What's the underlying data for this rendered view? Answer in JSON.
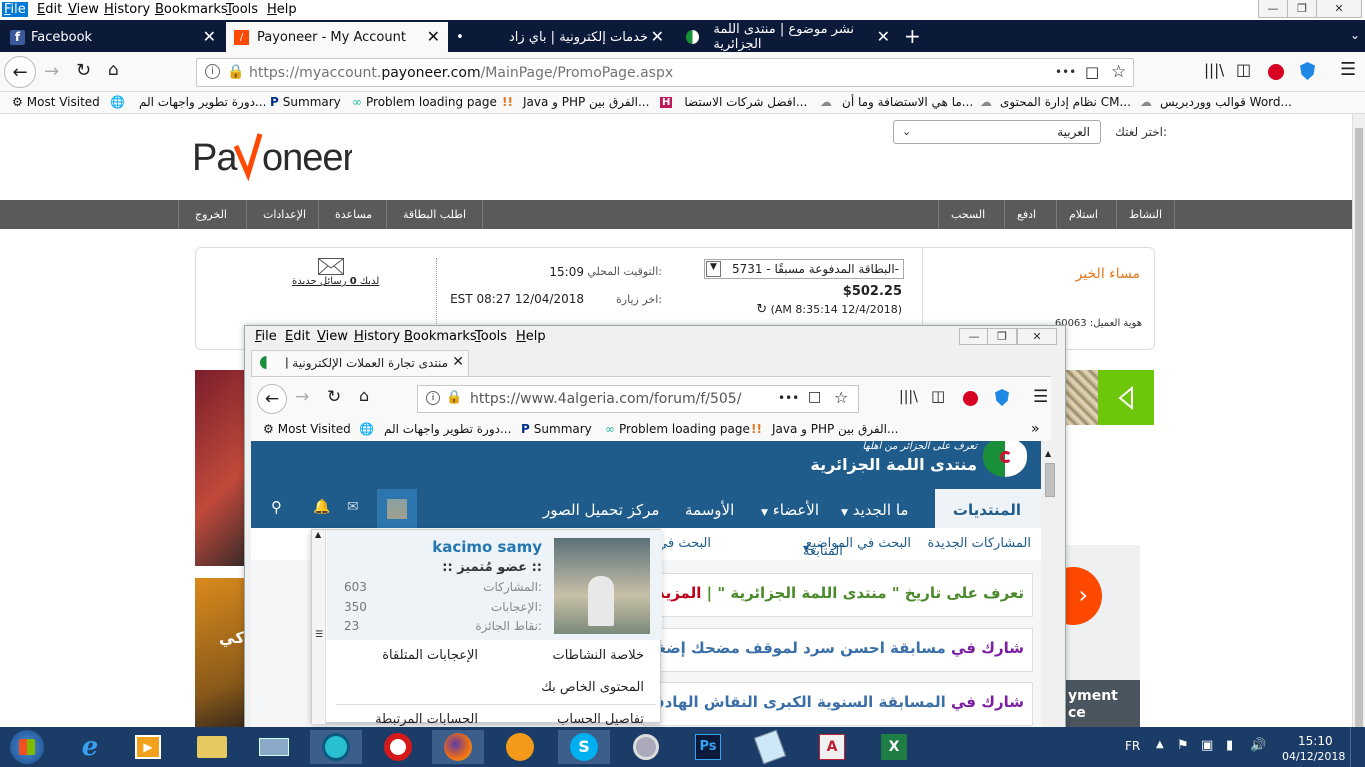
{
  "browser": {
    "menu": [
      "File",
      "Edit",
      "View",
      "History",
      "Bookmarks",
      "Tools",
      "Help"
    ],
    "tabs": [
      {
        "label": "Facebook"
      },
      {
        "label": "Payoneer - My Account"
      },
      {
        "label": "•"
      },
      {
        "label": "خدمات إلكترونية | باي زاد"
      },
      {
        "label": "نشر موضوع | منتدى اللمة الجزائرية"
      }
    ],
    "url_prefix": "https://myaccount.",
    "url_host": "payoneer.com",
    "url_path": "/MainPage/PromoPage.aspx",
    "url_more": "•••",
    "bookmarks": [
      "Most Visited",
      "دورة تطوير واجهات الم...",
      "Summary",
      "Problem loading page",
      "Java و PHP الفرق بين...",
      "افضل شركات الاستضا...",
      "ما هي الاستضافة وما أن...",
      "نظام إدارة المحتوى CM...",
      "قوالب ووردبريس Word..."
    ]
  },
  "payoneer": {
    "logo": "Payoneer",
    "lang_label": "اختر لغتك:",
    "lang_value": "العربية",
    "nav": [
      "النشاط",
      "استلام",
      "ادفع",
      "السحب",
      "اطلب البطاقة",
      "مساعدة",
      "الإعدادات",
      "الخروج"
    ],
    "greeting": "مساء الخير",
    "customer_label": "هوية العميل:",
    "customer_id": "60063",
    "card_select": "البطاقة المدفوعة مسبقًا - 5731-",
    "balance": "$502.25",
    "balance_time": "(AM 8:35:14 12/4/2018)",
    "local_time_label": "التوقيت المحلي:",
    "local_time": "15:09",
    "last_visit_label": "اخر زيارة:",
    "last_visit": "EST 08:27 12/04/2018",
    "messages_prefix": "لديك",
    "messages_count": "0",
    "messages_suffix": "رسائل جديدة"
  },
  "inner": {
    "menu": [
      "File",
      "Edit",
      "View",
      "History",
      "Bookmarks",
      "Tools",
      "Help"
    ],
    "tab": "منتدى تجارة العملات الإلكترونية [ بيع",
    "url": "https://www.4algeria.com/forum/f/505/",
    "url_more": "•••",
    "bookmarks": [
      "Most Visited",
      "دورة تطوير واجهات الم...",
      "Summary",
      "Problem loading page",
      "Java و PHP الفرق بين..."
    ],
    "forum": {
      "logo_tag": "تعرف على الجزائر من أهلها",
      "logo_name": "منتدى اللمة الجزائرية",
      "nav": [
        "المنتديات",
        "ما الجديد",
        "الأعضاء",
        "الأوسمة",
        "مركز تحميل الصور"
      ],
      "subnav": [
        "المشاركات الجديدة",
        "البحث في المواضيع",
        "المتابعة",
        "البحث في"
      ],
      "news": [
        {
          "pre": "تعرف على تاريخ \" منتدى اللمة الجزائرية \" |",
          "post": "المزيد..."
        },
        {
          "pre": "شارك في",
          "post": "مسابقة احسن سرد لموقف مضحك إضغط للمـ"
        },
        {
          "pre": "شارك في",
          "post": "المسابقة السنوية الكبرى النقاش الهادف إضـ"
        }
      ],
      "profile": {
        "name": "kacimo samy",
        "title": ":: عضو مُتميز ::",
        "stats": [
          {
            "label": "المشاركات:",
            "value": "603"
          },
          {
            "label": "الإعجابات:",
            "value": "350"
          },
          {
            "label": "نقاط الجائزة:",
            "value": "23"
          }
        ],
        "links": [
          "خلاصة النشاطات",
          "الإعجابات المتلقاة",
          "المحتوى الخاص بك",
          "تفاصيل الحساب",
          "الحسابات المرتبطة"
        ]
      }
    }
  },
  "side_text": {
    "payment": "yment",
    "ce": "ce",
    "ki": "كي"
  },
  "taskbar": {
    "lang": "FR",
    "time": "15:10",
    "date": "04/12/2018"
  },
  "colors": {
    "payoneer_orange": "#ff4800",
    "forum_blue": "#1f5c8b",
    "taskbar": "#1b3c67"
  }
}
